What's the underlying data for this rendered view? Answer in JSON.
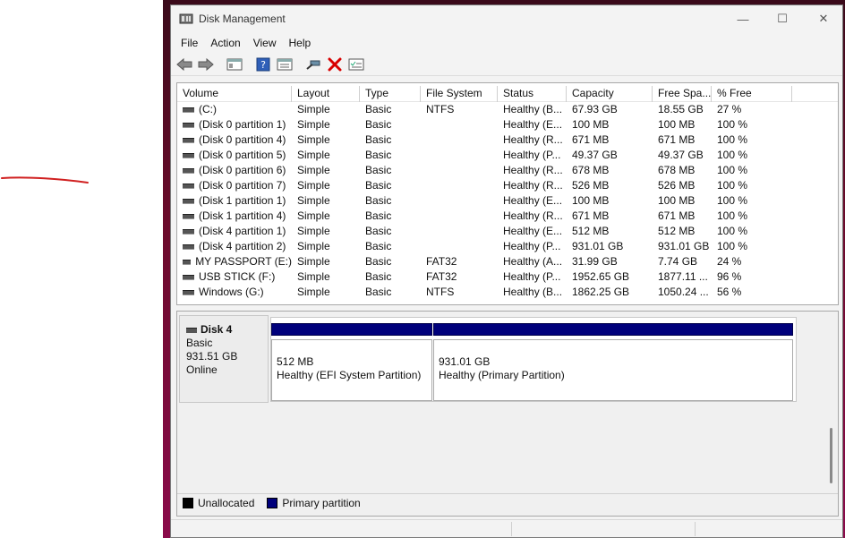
{
  "window": {
    "title": "Disk Management"
  },
  "controls": {
    "minimize": "—",
    "maximize": "☐",
    "close": "✕"
  },
  "menu": [
    "File",
    "Action",
    "View",
    "Help"
  ],
  "toolbar": [
    {
      "icon": "back-arrow-icon"
    },
    {
      "icon": "forward-arrow-icon"
    },
    {
      "icon": "show-hide-console-tree-icon"
    },
    {
      "icon": "help-icon"
    },
    {
      "icon": "properties-icon"
    },
    {
      "icon": "connect-icon"
    },
    {
      "icon": "delete-icon"
    },
    {
      "icon": "checklist-icon"
    }
  ],
  "columns": [
    "Volume",
    "Layout",
    "Type",
    "File System",
    "Status",
    "Capacity",
    "Free Spa...",
    "% Free"
  ],
  "volumes": [
    [
      "(C:)",
      "Simple",
      "Basic",
      "NTFS",
      "Healthy (B...",
      "67.93 GB",
      "18.55 GB",
      "27 %"
    ],
    [
      "(Disk 0 partition 1)",
      "Simple",
      "Basic",
      "",
      "Healthy (E...",
      "100 MB",
      "100 MB",
      "100 %"
    ],
    [
      "(Disk 0 partition 4)",
      "Simple",
      "Basic",
      "",
      "Healthy (R...",
      "671 MB",
      "671 MB",
      "100 %"
    ],
    [
      "(Disk 0 partition 5)",
      "Simple",
      "Basic",
      "",
      "Healthy (P...",
      "49.37 GB",
      "49.37 GB",
      "100 %"
    ],
    [
      "(Disk 0 partition 6)",
      "Simple",
      "Basic",
      "",
      "Healthy (R...",
      "678 MB",
      "678 MB",
      "100 %"
    ],
    [
      "(Disk 0 partition 7)",
      "Simple",
      "Basic",
      "",
      "Healthy (R...",
      "526 MB",
      "526 MB",
      "100 %"
    ],
    [
      "(Disk 1 partition 1)",
      "Simple",
      "Basic",
      "",
      "Healthy (E...",
      "100 MB",
      "100 MB",
      "100 %"
    ],
    [
      "(Disk 1 partition 4)",
      "Simple",
      "Basic",
      "",
      "Healthy (R...",
      "671 MB",
      "671 MB",
      "100 %"
    ],
    [
      "(Disk 4 partition 1)",
      "Simple",
      "Basic",
      "",
      "Healthy (E...",
      "512 MB",
      "512 MB",
      "100 %"
    ],
    [
      "(Disk 4 partition 2)",
      "Simple",
      "Basic",
      "",
      "Healthy (P...",
      "931.01 GB",
      "931.01 GB",
      "100 %"
    ],
    [
      "MY PASSPORT (E:)",
      "Simple",
      "Basic",
      "FAT32",
      "Healthy (A...",
      "31.99 GB",
      "7.74 GB",
      "24 %"
    ],
    [
      "USB STICK (F:)",
      "Simple",
      "Basic",
      "FAT32",
      "Healthy (P...",
      "1952.65 GB",
      "1877.11 ...",
      "96 %"
    ],
    [
      "Windows (G:)",
      "Simple",
      "Basic",
      "NTFS",
      "Healthy (B...",
      "1862.25 GB",
      "1050.24 ...",
      "56 %"
    ]
  ],
  "disk": {
    "name": "Disk 4",
    "type": "Basic",
    "size": "931.51 GB",
    "state": "Online",
    "partitions": [
      {
        "size": "512 MB",
        "status": "Healthy (EFI System Partition)"
      },
      {
        "size": "931.01 GB",
        "status": "Healthy (Primary Partition)"
      }
    ]
  },
  "legend": [
    {
      "label": "Unallocated",
      "color": "#000000"
    },
    {
      "label": "Primary partition",
      "color": "#00007b"
    }
  ]
}
